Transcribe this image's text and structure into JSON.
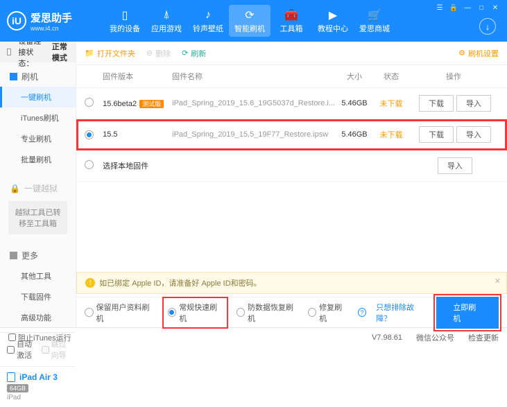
{
  "brand": {
    "cn": "爱思助手",
    "url": "www.i4.cn",
    "logo_letter": "iU"
  },
  "nav": [
    {
      "label": "我的设备"
    },
    {
      "label": "应用游戏"
    },
    {
      "label": "铃声壁纸"
    },
    {
      "label": "智能刷机"
    },
    {
      "label": "工具箱"
    },
    {
      "label": "教程中心"
    },
    {
      "label": "爱思商城"
    }
  ],
  "sidebar": {
    "conn_label": "设备连接状态：",
    "conn_value": "正常模式",
    "sec_flash": "刷机",
    "items_flash": [
      "一键刷机",
      "iTunes刷机",
      "专业刷机",
      "批量刷机"
    ],
    "sec_jail": "一键越狱",
    "jail_note": "越狱工具已转移至工具箱",
    "sec_more": "更多",
    "items_more": [
      "其他工具",
      "下载固件",
      "高级功能"
    ],
    "opt_auto": "自动激活",
    "opt_skip": "跳过向导",
    "device": {
      "name": "iPad Air 3",
      "storage": "64GB",
      "model": "iPad"
    }
  },
  "toolbar": {
    "open": "打开文件夹",
    "delete": "删除",
    "refresh": "刷新",
    "settings": "刷机设置"
  },
  "table": {
    "headers": {
      "ver": "固件版本",
      "name": "固件名称",
      "size": "大小",
      "status": "状态",
      "ops": "操作"
    },
    "rows": [
      {
        "ver": "15.6beta2",
        "beta": "测试版",
        "name": "iPad_Spring_2019_15.6_19G5037d_Restore.i...",
        "size": "5.46GB",
        "status": "未下载",
        "selected": false
      },
      {
        "ver": "15.5",
        "beta": "",
        "name": "iPad_Spring_2019_15.5_19F77_Restore.ipsw",
        "size": "5.46GB",
        "status": "未下载",
        "selected": true
      }
    ],
    "local_fw": "选择本地固件",
    "btn_download": "下载",
    "btn_import": "导入"
  },
  "notice": "如已绑定 Apple ID，请准备好 Apple ID和密码。",
  "modes": {
    "keep": "保留用户资料刷机",
    "normal": "常规快速刷机",
    "recover": "防数据恢复刷机",
    "repair": "修复刷机",
    "exclude": "只想排除故障？",
    "flash": "立即刷机"
  },
  "statusbar": {
    "block_itunes": "阻止iTunes运行",
    "version": "V7.98.61",
    "wechat": "微信公众号",
    "update": "检查更新"
  }
}
